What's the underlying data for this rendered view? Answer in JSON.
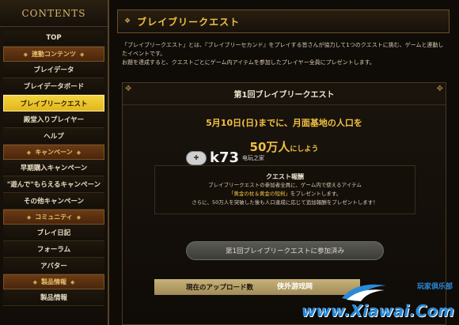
{
  "sidebar": {
    "title": "CONTENTS",
    "top_label": "TOP",
    "sections": [
      {
        "category": "連動コンテンツ",
        "items": [
          "ブレイデータ",
          "ブレイデータボード",
          "ブレイブリークエスト",
          "殿堂入りプレイヤー",
          "ヘルプ"
        ]
      },
      {
        "category": "キャンペーン",
        "items": [
          "早期購入キャンペーン",
          "\"遊んで\"もらえるキャンペーン",
          "その他キャンペーン"
        ]
      },
      {
        "category": "コミュニティ",
        "items": [
          "ブレイ日記",
          "フォーラム",
          "アバター"
        ]
      },
      {
        "category": "製品情報",
        "items": [
          "製品情報"
        ]
      }
    ],
    "active_item": "ブレイブリークエスト"
  },
  "main": {
    "header_title": "ブレイブリークエスト",
    "intro_line1": "「ブレイブリークエスト」とは、『ブレイブリーセカンド』をプレイする皆さんが協力して1つのクエストに挑む、ゲームと連動したイベントです。",
    "intro_line2": "お題を達成すると、クエストごとにゲーム内アイテムを参加したプレイヤー全員にプレゼントします。",
    "panel_title": "第1回ブレイブリークエスト",
    "goal_line1": "5月10日(日)までに、月面基地の人口を",
    "goal_big": "50万人",
    "goal_suffix": "にしよう",
    "reward_title": "クエスト報酬",
    "reward_line1": "ブレイブリークエストの参加者全員に、ゲーム内で使えるアイテム",
    "reward_highlight": "「黄金の杖＆黄金の短剣」",
    "reward_line2": "をプレゼントします。",
    "reward_line3": "さらに、50万人を突破した後も人口達成に応じて追加報酬をプレゼントします！",
    "joined_button": "第1回ブレイブリークエストに参加済み",
    "upload_label": "現在のアップロード数"
  },
  "watermarks": {
    "k73_logo": "k73",
    "k73_sub": "电玩之家",
    "site_cn_left": "侠外游戏网",
    "site_cn_right": "玩家俱乐部",
    "site_url": "www.Xiawai.Com"
  }
}
